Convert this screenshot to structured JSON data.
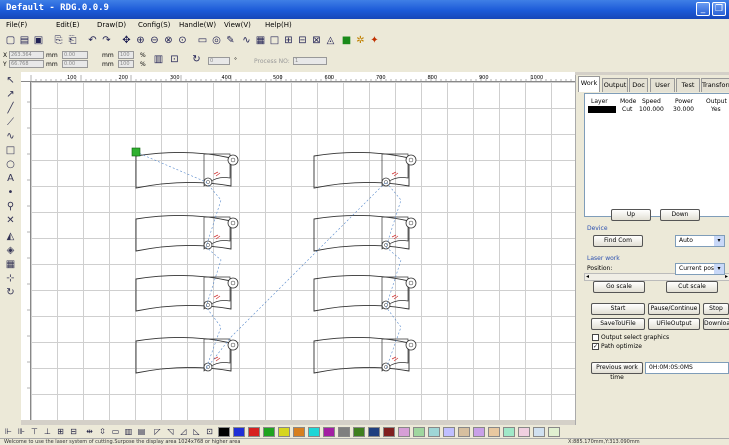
{
  "window": {
    "title": "Default - RDG.0.0.9"
  },
  "menu": [
    "File(F)",
    "Edit(E)",
    "Draw(D)",
    "Config(S)",
    "Handle(W)",
    "View(V)",
    "Help(H)"
  ],
  "toolbar2": {
    "x_label": "X",
    "y_label": "Y",
    "x_value": "263.364",
    "y_value": "66.768",
    "unit": "mm",
    "w_value": "0.00",
    "h_value": "0.00",
    "pct1": "100",
    "pct2": "100",
    "pct_symbol": "%",
    "angle_value": "0",
    "degree_symbol": "°",
    "process_no_label": "Process NO:",
    "process_no_value": "1"
  },
  "ruler_labels": [
    "100",
    "200",
    "300",
    "400",
    "500",
    "600",
    "700",
    "800",
    "900",
    "1000"
  ],
  "tabs": [
    "Work",
    "Output",
    "Doc",
    "User",
    "Test",
    "Transform"
  ],
  "layer_table": {
    "headers": [
      "Layer",
      "Mode",
      "Speed",
      "Power",
      "Output"
    ],
    "row": {
      "mode": "Cut",
      "speed": "100.000",
      "power": "30.000",
      "output": "Yes",
      "color": "#000000"
    }
  },
  "buttons": {
    "up": "Up",
    "down": "Down",
    "find_com": "Find Com",
    "go_scale": "Go scale",
    "cut_scale": "Cut scale",
    "start": "Start",
    "pause": "Pause/Continue",
    "stop": "Stop",
    "save_to_ufile": "SaveToUFile",
    "ufile_output": "UFileOutput",
    "download": "Download",
    "prev_work_time": "Previous work time"
  },
  "sections": {
    "device": "Device",
    "laser_work": "Laser work"
  },
  "device_combo": "Auto",
  "position_label": "Position:",
  "position_combo": "Current positio",
  "checkboxes": [
    {
      "label": "Output select graphics",
      "checked": false
    },
    {
      "label": "Path optimize",
      "checked": true
    }
  ],
  "work_time": "0H:0M:0S:0MS",
  "palette": [
    "#000000",
    "#1f2fd6",
    "#d62020",
    "#1fa31f",
    "#d6d61f",
    "#d67f1f",
    "#1fd6d6",
    "#a31fa3",
    "#7f7f7f",
    "#3f7f1f",
    "#1f3f7f",
    "#7f1f1f",
    "#d69fd6",
    "#9fd69f",
    "#9fd6d6",
    "#bfbfff",
    "#d6bf9f",
    "#c8a0e8",
    "#e8c8a0",
    "#a0e8c8",
    "#f0d0e0",
    "#d0e0f0",
    "#e0f0d0"
  ],
  "status": {
    "message": "Welcome to use the laser system of cutting.Surpose the display area 1024x768 or higher area",
    "coords": "X:885.170mm,Y:313.090mm"
  }
}
